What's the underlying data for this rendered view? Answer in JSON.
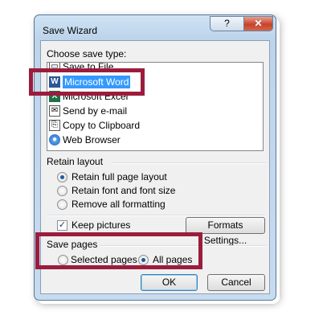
{
  "dialog": {
    "title": "Save Wizard",
    "help_label": "?",
    "close_label": "x"
  },
  "save_type": {
    "label": "Choose save type:",
    "items": [
      {
        "label": "Save to File",
        "icon": "file-icon"
      },
      {
        "label": "Microsoft Word",
        "icon": "word-icon",
        "selected": true
      },
      {
        "label": "Microsoft Excel",
        "icon": "excel-icon"
      },
      {
        "label": "Send by e-mail",
        "icon": "email-icon"
      },
      {
        "label": "Copy to Clipboard",
        "icon": "clipboard-icon"
      },
      {
        "label": "Web Browser",
        "icon": "globe-icon"
      }
    ]
  },
  "retain_layout": {
    "label": "Retain layout",
    "options": [
      {
        "label": "Retain full page layout",
        "checked": true
      },
      {
        "label": "Retain font and font size",
        "checked": false
      },
      {
        "label": "Remove all formatting",
        "checked": false
      }
    ]
  },
  "keep_pictures": {
    "label": "Keep pictures",
    "checked": true
  },
  "formats_button": "Formats Settings...",
  "save_pages": {
    "label": "Save pages",
    "options": [
      {
        "label": "Selected pages",
        "checked": false
      },
      {
        "label": "All pages",
        "checked": true
      }
    ]
  },
  "buttons": {
    "ok": "OK",
    "cancel": "Cancel"
  },
  "colors": {
    "highlight": "#9b1c3c",
    "selection": "#3399ff"
  }
}
